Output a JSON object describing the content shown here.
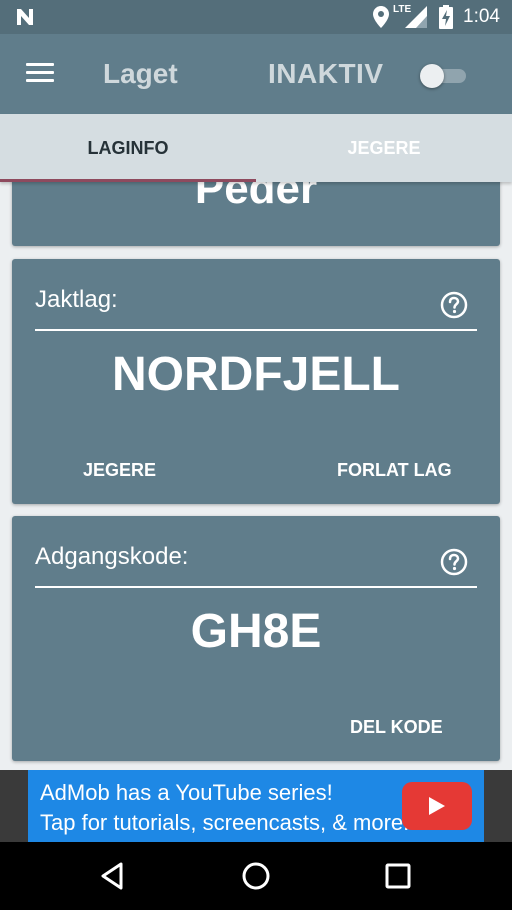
{
  "status_bar": {
    "network": "LTE",
    "time": "1:04"
  },
  "app_bar": {
    "title": "Laget",
    "status": "INAKTIV",
    "toggle_on": false
  },
  "tabs": [
    {
      "label": "LAGINFO",
      "active": true
    },
    {
      "label": "JEGERE",
      "active": false
    }
  ],
  "hunter_card": {
    "name": "Peder"
  },
  "team_card": {
    "label": "Jaktlag:",
    "value": "NORDFJELL",
    "actions": [
      "JEGERE",
      "FORLAT LAG"
    ]
  },
  "code_card": {
    "label": "Adgangskode:",
    "value": "GH8E",
    "action": "DEL KODE"
  },
  "ad": {
    "line1": "AdMob has a YouTube series!",
    "line2": "Tap for tutorials, screencasts, & more."
  },
  "icons": {
    "menu": "hamburger-menu-icon",
    "help": "question-circle-icon",
    "back": "triangle-back-icon",
    "home": "circle-home-icon",
    "recents": "square-recents-icon"
  },
  "colors": {
    "app_bar": "#607d8b",
    "status_bar": "#546e7a",
    "tab_indicator": "#8e4a5e",
    "card": "#607d8b",
    "ad_background": "#1e88e5"
  }
}
